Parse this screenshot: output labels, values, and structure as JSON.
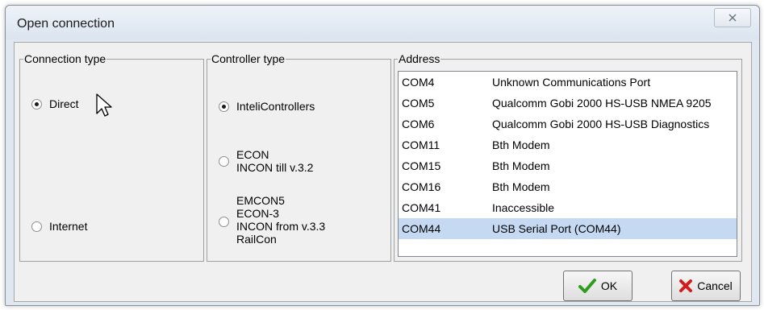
{
  "window": {
    "title": "Open connection"
  },
  "connection_type": {
    "label": "Connection type",
    "options": [
      {
        "label": "Direct",
        "checked": true
      },
      {
        "label": "Internet",
        "checked": false
      }
    ]
  },
  "controller_type": {
    "label": "Controller type",
    "options": [
      {
        "label": "InteliControllers",
        "checked": true
      },
      {
        "label": "ECON\nINCON till v.3.2",
        "checked": false
      },
      {
        "label": "EMCON5\nECON-3\nINCON from v.3.3\nRailCon",
        "checked": false
      }
    ]
  },
  "address": {
    "label": "Address",
    "rows": [
      {
        "port": "COM4",
        "description": "Unknown Communications Port"
      },
      {
        "port": "COM5",
        "description": "Qualcomm Gobi 2000 HS-USB NMEA 9205"
      },
      {
        "port": "COM6",
        "description": "Qualcomm Gobi 2000 HS-USB Diagnostics"
      },
      {
        "port": "COM11",
        "description": "Bth Modem"
      },
      {
        "port": "COM15",
        "description": "Bth Modem"
      },
      {
        "port": "COM16",
        "description": "Bth Modem"
      },
      {
        "port": "COM41",
        "description": "Inaccessible"
      },
      {
        "port": "COM44",
        "description": "USB Serial Port (COM44)"
      }
    ],
    "selected_index": 7
  },
  "buttons": {
    "ok": "OK",
    "cancel": "Cancel"
  },
  "colors": {
    "ok_check": "#2e9d1f",
    "cancel_x": "#d21d1d",
    "selection": "#c5daf2"
  }
}
